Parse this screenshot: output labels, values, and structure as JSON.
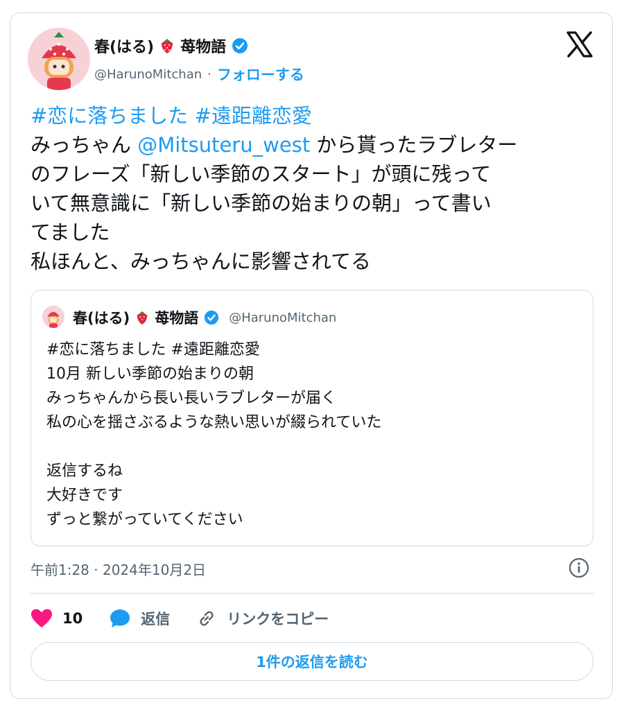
{
  "author": {
    "display_name": "春(はる)",
    "display_name_suffix": "苺物語",
    "handle": "@HarunoMitchan",
    "separator": "·",
    "follow_label": "フォローする"
  },
  "tweet": {
    "lines": [
      {
        "hashtags": [
          "#恋に落ちました",
          "#遠距離恋愛"
        ]
      },
      {
        "pre": "みっちゃん ",
        "mention": "@Mitsuteru_west",
        "post": " から貰ったラブレター"
      },
      {
        "text": "のフレーズ「新しい季節のスタート」が頭に残って"
      },
      {
        "text": "いて無意識に「新しい季節の始まりの朝」って書い"
      },
      {
        "text": "てました"
      },
      {
        "text": "私ほんと、みっちゃんに影響されてる"
      }
    ]
  },
  "quoted_tweet": {
    "display_name": "春(はる)",
    "display_name_suffix": "苺物語",
    "handle": "@HarunoMitchan",
    "lines": [
      "#恋に落ちました #遠距離恋愛",
      "10月 新しい季節の始まりの朝",
      "みっちゃんから長い長いラブレターが届く",
      "私の心を揺さぶるような熱い思いが綴られていた",
      "",
      "返信するね",
      "大好きです",
      "ずっと繋がっていてください"
    ]
  },
  "timestamp": "午前1:28 · 2024年10月2日",
  "actions": {
    "like_count": "10",
    "reply_label": "返信",
    "copy_link_label": "リンクをコピー"
  },
  "read_replies_label": "1件の返信を読む",
  "colors": {
    "accent": "#1d9bf0",
    "heart": "#f91880",
    "text": "#0f1419",
    "muted": "#536471"
  }
}
